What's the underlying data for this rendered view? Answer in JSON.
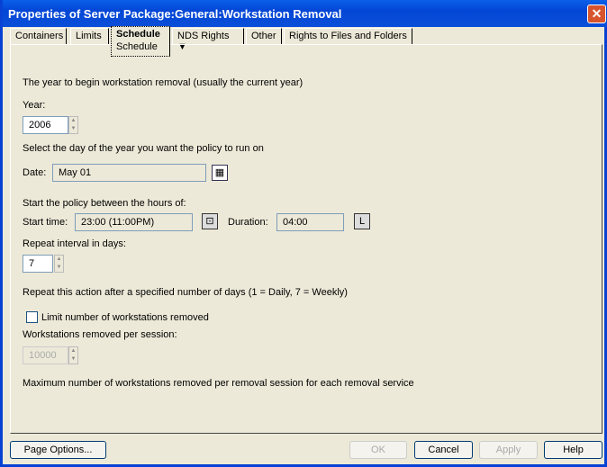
{
  "title": "Properties of Server Package:General:Workstation Removal",
  "tabs": [
    "Containers",
    "Limits",
    "Schedule",
    "NDS Rights",
    "Other",
    "Rights to Files and Folders"
  ],
  "subtab": "Schedule",
  "year_desc": "The year to begin workstation removal (usually the current year)",
  "year_label": "Year:",
  "year_value": "2006",
  "day_desc": "Select the day of the year you want the policy to run on",
  "date_label": "Date:",
  "date_value": "May 01",
  "hours_desc": "Start the policy between the hours of:",
  "start_label": "Start time:",
  "start_value": "23:00 (11:00PM)",
  "duration_label": "Duration:",
  "duration_value": "04:00",
  "repeat_label": "Repeat interval in days:",
  "repeat_value": "7",
  "repeat_desc": "Repeat this action after a specified number of days (1 = Daily, 7 = Weekly)",
  "limit_label": "Limit number of workstations removed",
  "per_session_label": "Workstations removed per session:",
  "per_session_value": "10000",
  "max_desc": "Maximum number of workstations removed per removal session for each removal service",
  "buttons": {
    "page_options": "Page Options...",
    "ok": "OK",
    "cancel": "Cancel",
    "apply": "Apply",
    "help": "Help"
  }
}
